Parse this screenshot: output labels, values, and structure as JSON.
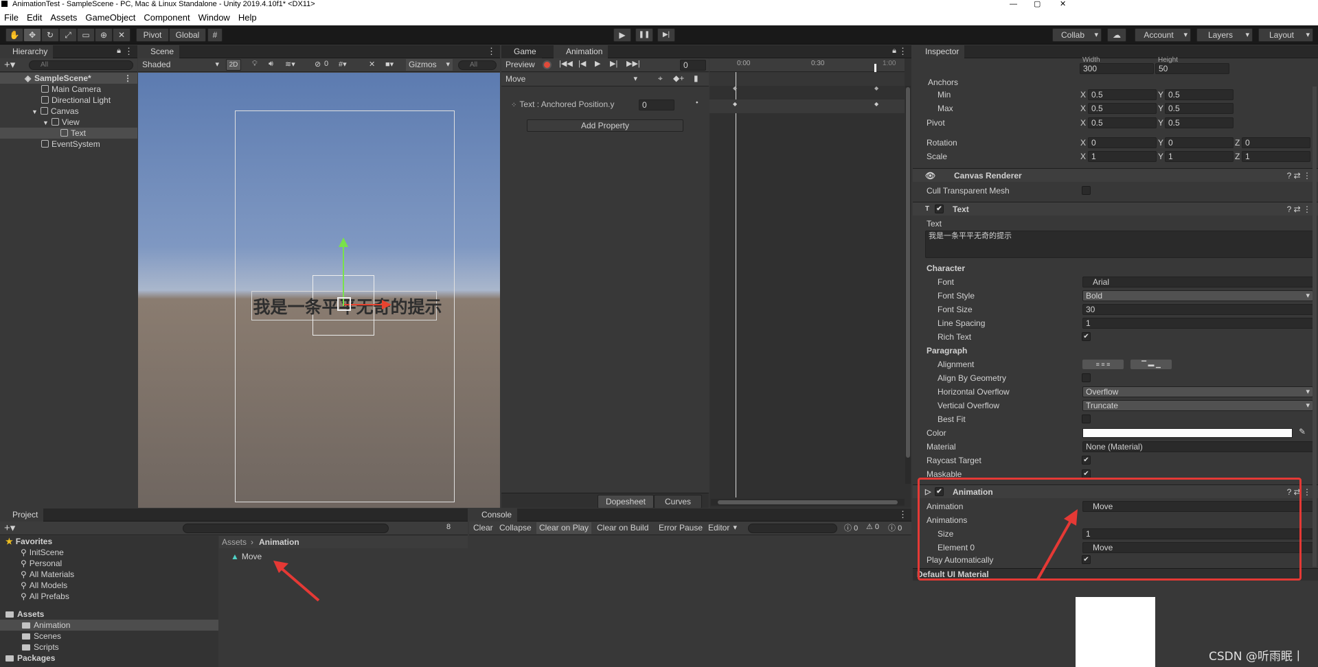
{
  "window": {
    "title": "AnimationTest - SampleScene - PC, Mac & Linux Standalone - Unity 2019.4.10f1* <DX11>",
    "min": "—",
    "max": "▢",
    "close": "✕"
  },
  "menu": [
    "File",
    "Edit",
    "Assets",
    "GameObject",
    "Component",
    "Window",
    "Help"
  ],
  "toolbar": {
    "pivot": "Pivot",
    "global": "Global",
    "play": "▶",
    "pause": "❚❚",
    "step": "▶|",
    "collab": "Collab",
    "account": "Account",
    "layers": "Layers",
    "layout": "Layout"
  },
  "hierarchy": {
    "tab": "Hierarchy",
    "search": "All",
    "items": [
      {
        "label": "SampleScene*"
      },
      {
        "label": "Main Camera"
      },
      {
        "label": "Directional Light"
      },
      {
        "label": "Canvas"
      },
      {
        "label": "View"
      },
      {
        "label": "Text"
      },
      {
        "label": "EventSystem"
      }
    ]
  },
  "scene": {
    "tab": "Scene",
    "shading": "Shaded",
    "mode2d": "2D",
    "gizmos": "Gizmos",
    "search": "All",
    "hidden_count": "0",
    "text": "我是一条平平无奇的提示"
  },
  "animation": {
    "tab_game": "Game",
    "tab_anim": "Animation",
    "preview": "Preview",
    "frame": "0",
    "clip": "Move",
    "property": "Text : Anchored Position.y",
    "property_value": "0",
    "add_property": "Add Property",
    "time_0": "0:00",
    "time_30": "0:30",
    "time_100": "1:00",
    "dopesheet": "Dopesheet",
    "curves": "Curves"
  },
  "inspector": {
    "tab": "Inspector",
    "width_label": "Width",
    "height_label": "Height",
    "width": "300",
    "height": "50",
    "anchors": "Anchors",
    "min": "Min",
    "max": "Max",
    "pivot": "Pivot",
    "rotation": "Rotation",
    "scale": "Scale",
    "axis_x": "X",
    "axis_y": "Y",
    "axis_z": "Z",
    "min_x": "0.5",
    "min_y": "0.5",
    "max_x": "0.5",
    "max_y": "0.5",
    "pivot_x": "0.5",
    "pivot_y": "0.5",
    "rot_x": "0",
    "rot_y": "0",
    "rot_z": "0",
    "scale_x": "1",
    "scale_y": "1",
    "scale_z": "1",
    "canvas_renderer": "Canvas Renderer",
    "cull": "Cull Transparent Mesh",
    "text_comp": "Text",
    "text_label": "Text",
    "text_value": "我是一条平平无奇的提示",
    "character": "Character",
    "font": "Font",
    "font_value": "Arial",
    "font_style": "Font Style",
    "font_style_value": "Bold",
    "font_size": "Font Size",
    "font_size_value": "30",
    "line_spacing": "Line Spacing",
    "line_spacing_value": "1",
    "rich_text": "Rich Text",
    "paragraph": "Paragraph",
    "alignment": "Alignment",
    "align_geo": "Align By Geometry",
    "h_overflow": "Horizontal Overflow",
    "h_overflow_value": "Overflow",
    "v_overflow": "Vertical Overflow",
    "v_overflow_value": "Truncate",
    "best_fit": "Best Fit",
    "color": "Color",
    "material": "Material",
    "material_value": "None (Material)",
    "raycast": "Raycast Target",
    "maskable": "Maskable",
    "anim_comp": "Animation",
    "animation": "Animation",
    "animation_value": "Move",
    "animations": "Animations",
    "size": "Size",
    "size_value": "1",
    "element0": "Element 0",
    "element0_value": "Move",
    "play_auto": "Play Automatically",
    "default_mat": "Default UI Material"
  },
  "project": {
    "tab": "Project",
    "badge": "8",
    "favorites": "Favorites",
    "fav_items": [
      "InitScene",
      "Personal",
      "All Materials",
      "All Models",
      "All Prefabs"
    ],
    "assets": "Assets",
    "asset_items": [
      "Animation",
      "Scenes",
      "Scripts"
    ],
    "packages": "Packages",
    "breadcrumb_root": "Assets",
    "breadcrumb_cur": "Animation",
    "file": "Move"
  },
  "console": {
    "tab": "Console",
    "clear": "Clear",
    "collapse": "Collapse",
    "clear_on_play": "Clear on Play",
    "clear_on_build": "Clear on Build",
    "error_pause": "Error Pause",
    "editor": "Editor",
    "c1": "0",
    "c2": "0",
    "c3": "0"
  },
  "watermark": "CSDN @听雨眠丨",
  "colors": {
    "highlight": "#e53935",
    "accent": "#4c7fff",
    "bg": "#383838"
  }
}
